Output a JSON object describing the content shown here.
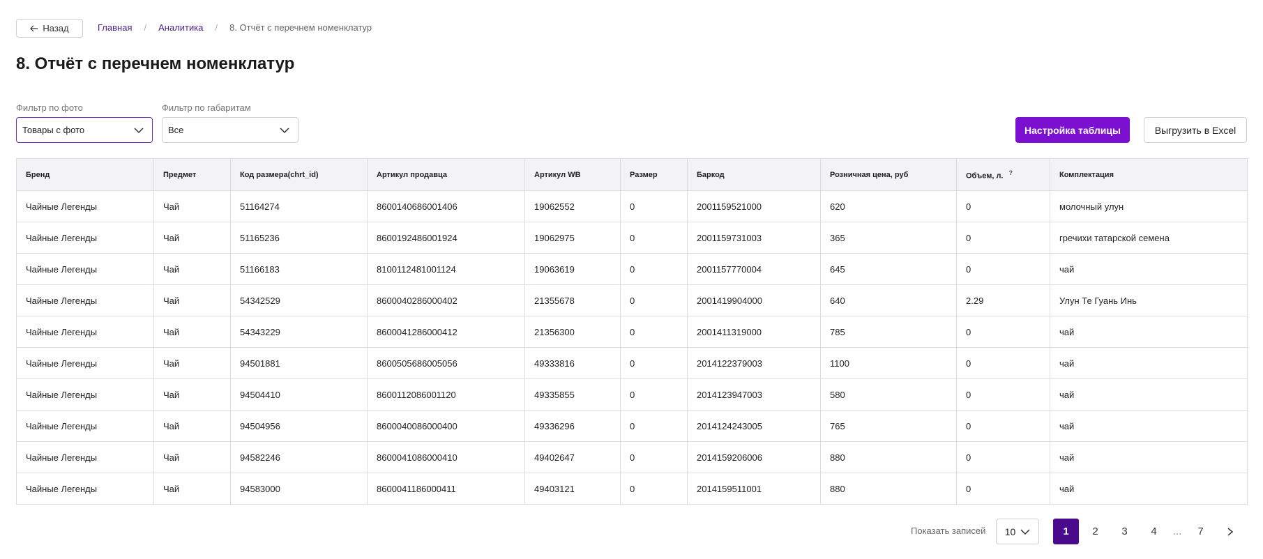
{
  "nav": {
    "back_label": "Назад",
    "breadcrumb": [
      "Главная",
      "Аналитика",
      "8. Отчёт с перечнем номенклатур"
    ]
  },
  "page_title": "8. Отчёт с перечнем номенклатур",
  "filters": {
    "photo": {
      "label": "Фильтр по фото",
      "value": "Товары с фото"
    },
    "dims": {
      "label": "Фильтр по габаритам",
      "value": "Все"
    }
  },
  "actions": {
    "settings_label": "Настройка таблицы",
    "export_label": "Выгрузить в Excel"
  },
  "table": {
    "columns": [
      "Бренд",
      "Предмет",
      "Код размера(chrt_id)",
      "Артикул продавца",
      "Артикул WB",
      "Размер",
      "Баркод",
      "Розничная цена, руб",
      "Объем, л.",
      "Комплектация"
    ],
    "help_mark": "?",
    "rows": [
      [
        "Чайные Легенды",
        "Чай",
        "51164274",
        "8600140686001406",
        "19062552",
        "0",
        "2001159521000",
        "620",
        "0",
        "молочный улун"
      ],
      [
        "Чайные Легенды",
        "Чай",
        "51165236",
        "8600192486001924",
        "19062975",
        "0",
        "2001159731003",
        "365",
        "0",
        "гречихи татарской семена"
      ],
      [
        "Чайные Легенды",
        "Чай",
        "51166183",
        "8100112481001124",
        "19063619",
        "0",
        "2001157770004",
        "645",
        "0",
        "чай"
      ],
      [
        "Чайные Легенды",
        "Чай",
        "54342529",
        "8600040286000402",
        "21355678",
        "0",
        "2001419904000",
        "640",
        "2.29",
        "Улун Те Гуань Инь"
      ],
      [
        "Чайные Легенды",
        "Чай",
        "54343229",
        "8600041286000412",
        "21356300",
        "0",
        "2001411319000",
        "785",
        "0",
        "чай"
      ],
      [
        "Чайные Легенды",
        "Чай",
        "94501881",
        "8600505686005056",
        "49333816",
        "0",
        "2014122379003",
        "1100",
        "0",
        "чай"
      ],
      [
        "Чайные Легенды",
        "Чай",
        "94504410",
        "8600112086001120",
        "49335855",
        "0",
        "2014123947003",
        "580",
        "0",
        "чай"
      ],
      [
        "Чайные Легенды",
        "Чай",
        "94504956",
        "8600040086000400",
        "49336296",
        "0",
        "2014124243005",
        "765",
        "0",
        "чай"
      ],
      [
        "Чайные Легенды",
        "Чай",
        "94582246",
        "8600041086000410",
        "49402647",
        "0",
        "2014159206006",
        "880",
        "0",
        "чай"
      ],
      [
        "Чайные Легенды",
        "Чай",
        "94583000",
        "8600041186000411",
        "49403121",
        "0",
        "2014159511001",
        "880",
        "0",
        "чай"
      ]
    ]
  },
  "pagination": {
    "show_label": "Показать записей",
    "page_size": "10",
    "pages": [
      "1",
      "2",
      "3",
      "4",
      "...",
      "7"
    ],
    "current": "1"
  },
  "colors": {
    "accent": "#7b10d0",
    "active_page": "#4a0a8c",
    "link": "#4a1f8c"
  }
}
